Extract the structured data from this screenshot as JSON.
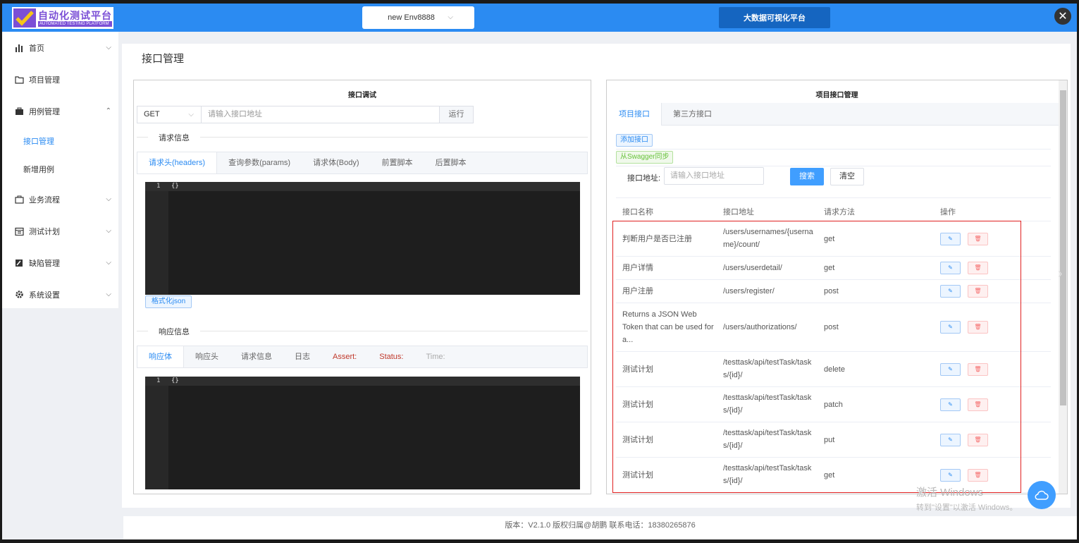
{
  "header": {
    "logo_title": "自动化测试平台",
    "logo_subtitle": "AUTOMATED TESTING PLATFORM",
    "env_selected": "new Env8888",
    "bigdata_label": "大数据可视化平台",
    "close_symbol": "✕",
    "chevron_symbol": "⌵"
  },
  "sidebar": {
    "items": [
      {
        "label": "首页",
        "icon": "bar-chart-icon",
        "chev": "⌵"
      },
      {
        "label": "项目管理",
        "icon": "folder-icon"
      },
      {
        "label": "用例管理",
        "icon": "briefcase-icon",
        "chev": "⌃"
      },
      {
        "label": "业务流程",
        "icon": "suitcase-icon",
        "chev": "⌵"
      },
      {
        "label": "测试计划",
        "icon": "calendar-icon",
        "chev": "⌵"
      },
      {
        "label": "缺陷管理",
        "icon": "edit-icon",
        "chev": "⌵"
      },
      {
        "label": "系统设置",
        "icon": "gear-icon",
        "chev": "⌵"
      }
    ],
    "sub_items": [
      {
        "label": "接口管理",
        "active": true
      },
      {
        "label": "新增用例",
        "active": false
      }
    ]
  },
  "main": {
    "page_title": "接口管理"
  },
  "debug_panel": {
    "title": "接口调试",
    "method": "GET",
    "url_placeholder": "请输入接口地址",
    "run_label": "运行",
    "request_divider": "请求信息",
    "request_tabs": [
      "请求头(headers)",
      "查询参数(params)",
      "请求体(Body)",
      "前置脚本",
      "后置脚本"
    ],
    "editor_line": "1",
    "editor_content": "{}",
    "format_label": "格式化json",
    "response_divider": "响应信息",
    "response_tabs": [
      "响应体",
      "响应头",
      "请求信息",
      "日志",
      "Assert:",
      "Status:",
      "Time:"
    ],
    "response_line": "1",
    "response_content": "{}"
  },
  "api_panel": {
    "title": "项目接口管理",
    "tabs": [
      "项目接口",
      "第三方接口"
    ],
    "add_label": "添加接口",
    "swagger_label": "从Swagger同步",
    "search_label": "接口地址:",
    "search_placeholder": "请输入接口地址",
    "search_btn": "搜索",
    "clear_btn": "清空",
    "columns": [
      "接口名称",
      "接口地址",
      "请求方法",
      "操作"
    ],
    "rows": [
      {
        "name": "判断用户是否已注册",
        "url": "/users/usernames/{username}/count/",
        "method": "get"
      },
      {
        "name": "用户详情",
        "url": "/users/userdetail/",
        "method": "get"
      },
      {
        "name": "用户注册",
        "url": "/users/register/",
        "method": "post"
      },
      {
        "name": "Returns a JSON Web Token that can be used for a...",
        "url": "/users/authorizations/",
        "method": "post"
      },
      {
        "name": "测试计划",
        "url": "/testtask/api/testTask/tasks/{id}/",
        "method": "delete"
      },
      {
        "name": "测试计划",
        "url": "/testtask/api/testTask/tasks/{id}/",
        "method": "patch"
      },
      {
        "name": "测试计划",
        "url": "/testtask/api/testTask/tasks/{id}/",
        "method": "put"
      },
      {
        "name": "测试计划",
        "url": "/testtask/api/testTask/tasks/{id}/",
        "method": "get"
      }
    ],
    "edit_icon": "✎",
    "delete_icon": "🗑"
  },
  "footer": {
    "text": "版本：V2.1.0 版权归属@胡鹏 联系电话：18380265876"
  },
  "watermark": {
    "line1": "激活 Windows",
    "line2": "转到\"设置\"以激活 Windows。"
  },
  "colors": {
    "header_blue": "#2b8bf2",
    "accent": "#409eff",
    "highlight_red": "#e02020"
  }
}
